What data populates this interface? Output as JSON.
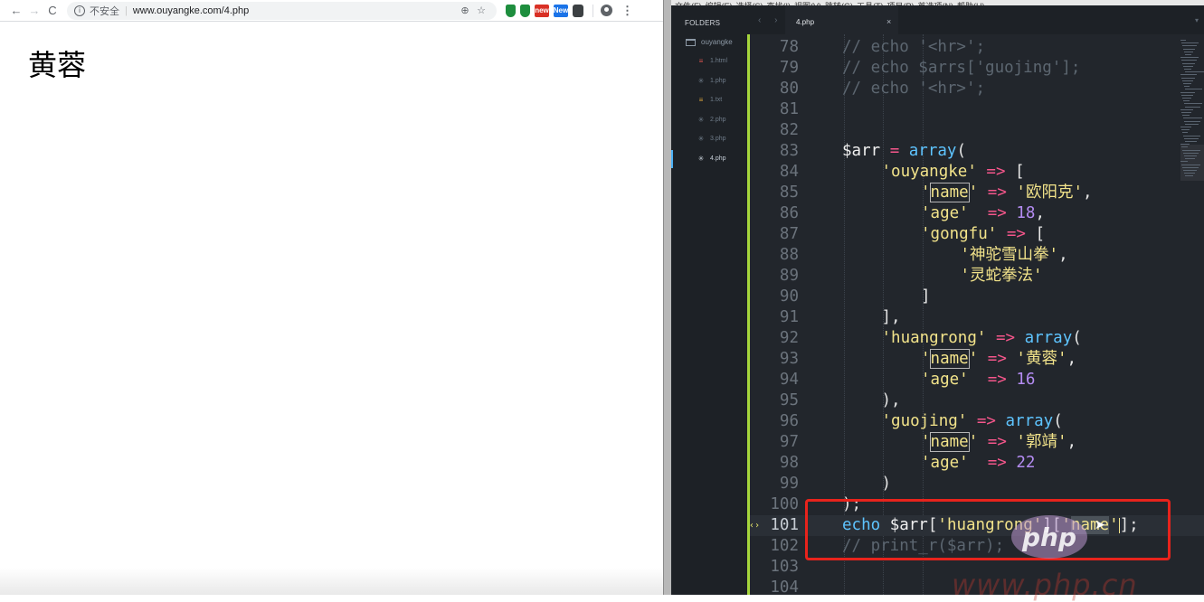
{
  "browser": {
    "nav": {
      "back_icon": "←",
      "forward_icon": "→",
      "reload_icon": "C"
    },
    "omnibox": {
      "security_label": "不安全",
      "url": "www.ouyangke.com/4.php"
    },
    "icons": {
      "zoom_icon": "⊕",
      "star_icon": "☆",
      "menu_icon": "⋮"
    },
    "extensions": {
      "new_badge_1": "new",
      "new_badge_2": "New"
    },
    "page_text": "黄蓉"
  },
  "editor": {
    "menubar": [
      "文件(F)",
      "编辑(E)",
      "选择(S)",
      "查找(I)",
      "视图(V)",
      "跳转(G)",
      "工具(T)",
      "项目(P)",
      "首选项(N)",
      "帮助(H)"
    ],
    "sidebar": {
      "header": "FOLDERS",
      "folder": "ouyangke",
      "files": [
        {
          "name": "1.html",
          "icon": "≡",
          "color": "#d9534f"
        },
        {
          "name": "1.php",
          "icon": "✳",
          "color": "#6f7c89"
        },
        {
          "name": "1.txt",
          "icon": "≡",
          "color": "#d9a43c"
        },
        {
          "name": "2.php",
          "icon": "✳",
          "color": "#6f7c89"
        },
        {
          "name": "3.php",
          "icon": "✳",
          "color": "#6f7c89"
        },
        {
          "name": "4.php",
          "icon": "✳",
          "color": "#c5cdd6"
        }
      ]
    },
    "tab": {
      "title": "4.php",
      "close": "×",
      "arrows": "‹ ›",
      "dropdown": "▾"
    },
    "lines": [
      {
        "n": "78",
        "tokens": [
          [
            "c",
            "// echo '<hr>';"
          ]
        ],
        "indent": 0
      },
      {
        "n": "79",
        "tokens": [
          [
            "c",
            "// echo $arrs['guojing'];"
          ]
        ],
        "indent": 0
      },
      {
        "n": "80",
        "tokens": [
          [
            "c",
            "// echo '<hr>';"
          ]
        ],
        "indent": 0
      },
      {
        "n": "81",
        "tokens": [],
        "indent": 0
      },
      {
        "n": "82",
        "tokens": [],
        "indent": 0
      },
      {
        "n": "83",
        "tokens": [
          [
            "v",
            "$arr "
          ],
          [
            "o",
            "= "
          ],
          [
            "k",
            "array"
          ],
          [
            "p",
            "("
          ]
        ],
        "indent": 0
      },
      {
        "n": "84",
        "tokens": [
          [
            "s",
            "'ouyangke'"
          ],
          [
            "p",
            " "
          ],
          [
            "o",
            "=>"
          ],
          [
            "p",
            " ["
          ]
        ],
        "indent": 1
      },
      {
        "n": "85",
        "tokens": [
          [
            "s",
            "'"
          ],
          [
            "hl",
            "name"
          ],
          [
            "s",
            "'"
          ],
          [
            "p",
            " "
          ],
          [
            "o",
            "=>"
          ],
          [
            "p",
            " "
          ],
          [
            "s",
            "'欧阳克'"
          ],
          [
            "p",
            ","
          ]
        ],
        "indent": 2
      },
      {
        "n": "86",
        "tokens": [
          [
            "s",
            "'age'"
          ],
          [
            "p",
            "  "
          ],
          [
            "o",
            "=>"
          ],
          [
            "p",
            " "
          ],
          [
            "n",
            "18"
          ],
          [
            "p",
            ","
          ]
        ],
        "indent": 2
      },
      {
        "n": "87",
        "tokens": [
          [
            "s",
            "'gongfu'"
          ],
          [
            "p",
            " "
          ],
          [
            "o",
            "=>"
          ],
          [
            "p",
            " ["
          ]
        ],
        "indent": 2
      },
      {
        "n": "88",
        "tokens": [
          [
            "s",
            "'神驼雪山拳'"
          ],
          [
            "p",
            ","
          ]
        ],
        "indent": 3
      },
      {
        "n": "89",
        "tokens": [
          [
            "s",
            "'灵蛇拳法'"
          ]
        ],
        "indent": 3
      },
      {
        "n": "90",
        "tokens": [
          [
            "p",
            "]"
          ]
        ],
        "indent": 2
      },
      {
        "n": "91",
        "tokens": [
          [
            "p",
            "],"
          ]
        ],
        "indent": 1
      },
      {
        "n": "92",
        "tokens": [
          [
            "s",
            "'huangrong'"
          ],
          [
            "p",
            " "
          ],
          [
            "o",
            "=>"
          ],
          [
            "p",
            " "
          ],
          [
            "k",
            "array"
          ],
          [
            "p",
            "("
          ]
        ],
        "indent": 1
      },
      {
        "n": "93",
        "tokens": [
          [
            "s",
            "'"
          ],
          [
            "hl",
            "name"
          ],
          [
            "s",
            "'"
          ],
          [
            "p",
            " "
          ],
          [
            "o",
            "=>"
          ],
          [
            "p",
            " "
          ],
          [
            "s",
            "'黄蓉'"
          ],
          [
            "p",
            ","
          ]
        ],
        "indent": 2
      },
      {
        "n": "94",
        "tokens": [
          [
            "s",
            "'age'"
          ],
          [
            "p",
            "  "
          ],
          [
            "o",
            "=>"
          ],
          [
            "p",
            " "
          ],
          [
            "n",
            "16"
          ]
        ],
        "indent": 2
      },
      {
        "n": "95",
        "tokens": [
          [
            "p",
            "),"
          ]
        ],
        "indent": 1
      },
      {
        "n": "96",
        "tokens": [
          [
            "s",
            "'guojing'"
          ],
          [
            "p",
            " "
          ],
          [
            "o",
            "=>"
          ],
          [
            "p",
            " "
          ],
          [
            "k",
            "array"
          ],
          [
            "p",
            "("
          ]
        ],
        "indent": 1
      },
      {
        "n": "97",
        "tokens": [
          [
            "s",
            "'"
          ],
          [
            "hl",
            "name"
          ],
          [
            "s",
            "'"
          ],
          [
            "p",
            " "
          ],
          [
            "o",
            "=>"
          ],
          [
            "p",
            " "
          ],
          [
            "s",
            "'郭靖'"
          ],
          [
            "p",
            ","
          ]
        ],
        "indent": 2
      },
      {
        "n": "98",
        "tokens": [
          [
            "s",
            "'age'"
          ],
          [
            "p",
            "  "
          ],
          [
            "o",
            "=>"
          ],
          [
            "p",
            " "
          ],
          [
            "n",
            "22"
          ]
        ],
        "indent": 2
      },
      {
        "n": "99",
        "tokens": [
          [
            "p",
            ")"
          ]
        ],
        "indent": 1
      },
      {
        "n": "100",
        "tokens": [
          [
            "p",
            ");"
          ]
        ],
        "indent": 0
      },
      {
        "n": "101",
        "tokens": [
          [
            "k",
            "echo"
          ],
          [
            "p",
            " "
          ],
          [
            "v",
            "$arr"
          ],
          [
            "p",
            "["
          ],
          [
            "s",
            "'huangrong'"
          ],
          [
            "p",
            "]["
          ],
          [
            "s",
            "'"
          ],
          [
            "sel",
            "name"
          ],
          [
            "s",
            "'"
          ],
          [
            "cur",
            ""
          ],
          [
            "p",
            "];"
          ]
        ],
        "indent": 0,
        "current": true
      },
      {
        "n": "102",
        "tokens": [
          [
            "c",
            "// print_r($arr);"
          ]
        ],
        "indent": 0
      },
      {
        "n": "103",
        "tokens": [],
        "indent": 0
      },
      {
        "n": "104",
        "tokens": [],
        "indent": 0
      }
    ]
  },
  "watermark": {
    "logo": "php",
    "url": "www.php.cn"
  }
}
